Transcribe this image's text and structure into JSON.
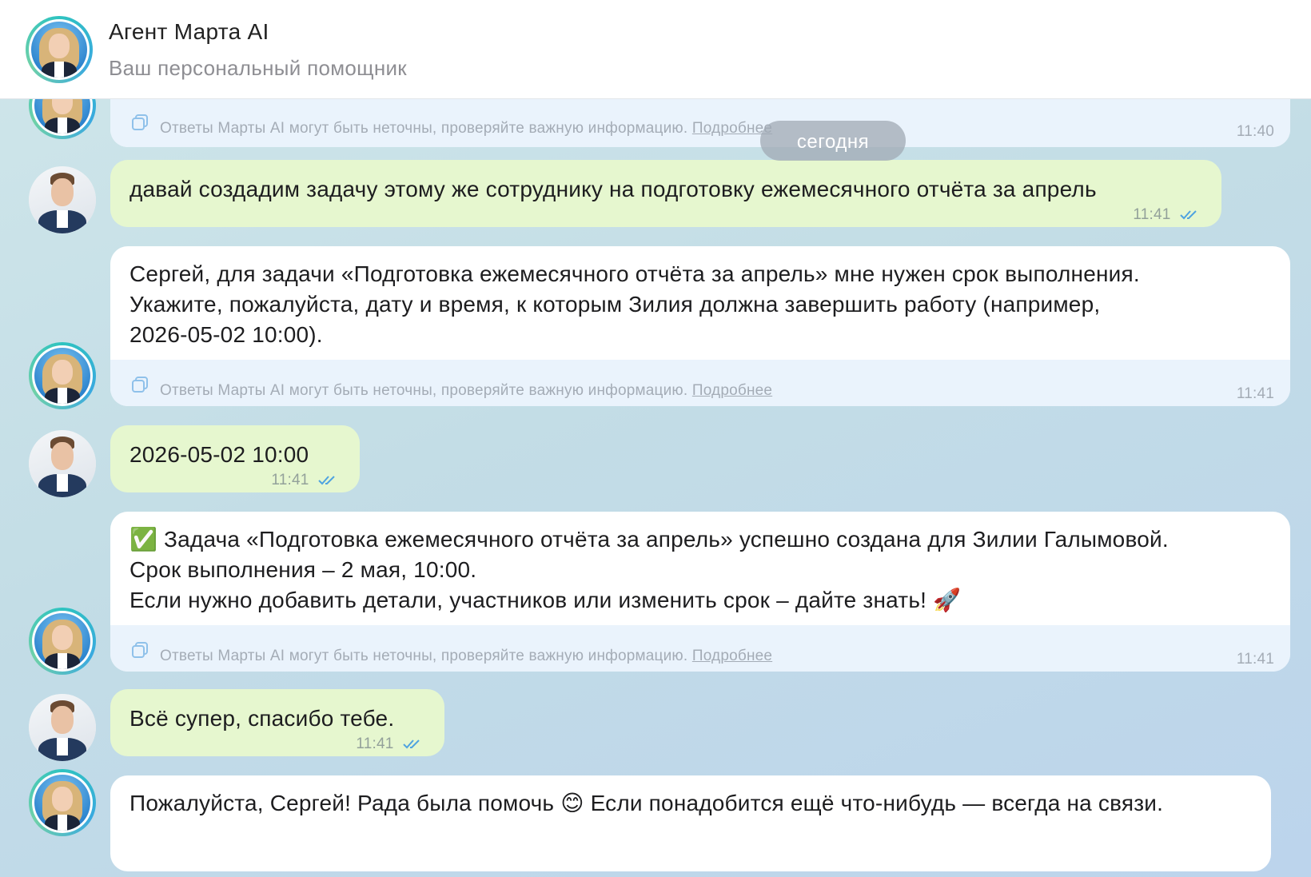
{
  "header": {
    "title": "Агент Марта AI",
    "subtitle": "Ваш персональный помощник"
  },
  "date_divider": "сегодня",
  "disclaimer": {
    "text": "Ответы Марты AI могут быть неточны, проверяйте важную информацию.",
    "link": "Подробнее"
  },
  "messages": [
    {
      "from": "agent",
      "time": "11:40"
    },
    {
      "from": "user",
      "text": "давай создадим задачу этому же сотруднику на подготовку ежемесячного отчёта за апрель",
      "time": "11:41"
    },
    {
      "from": "agent",
      "lines": [
        "Сергей, для задачи «Подготовка ежемесячного отчёта за апрель» мне нужен срок выполнения.",
        "Укажите, пожалуйста, дату и время, к которым Зилия должна завершить работу (например,",
        "2026-05-02 10:00)."
      ],
      "time": "11:41"
    },
    {
      "from": "user",
      "text": "2026-05-02 10:00",
      "time": "11:41"
    },
    {
      "from": "agent",
      "lines": [
        "✅ Задача «Подготовка ежемесячного отчёта за апрель» успешно создана для Зилии Галымовой.",
        "Срок выполнения – 2 мая, 10:00.",
        "Если нужно добавить детали, участников или изменить срок – дайте знать! 🚀"
      ],
      "time": "11:41"
    },
    {
      "from": "user",
      "text": "Всё супер, спасибо тебе.",
      "time": "11:41"
    },
    {
      "from": "agent",
      "lines": [
        "Пожалуйста, Сергей! Рада была помочь 😊 Если понадобится ещё что-нибудь — всегда на связи."
      ]
    }
  ],
  "colors": {
    "user_bubble": "#e6f7cf",
    "agent_bubble": "#ffffff",
    "disclaimer_bg": "#eaf3fc",
    "read_ticks": "#4fa3e0"
  }
}
